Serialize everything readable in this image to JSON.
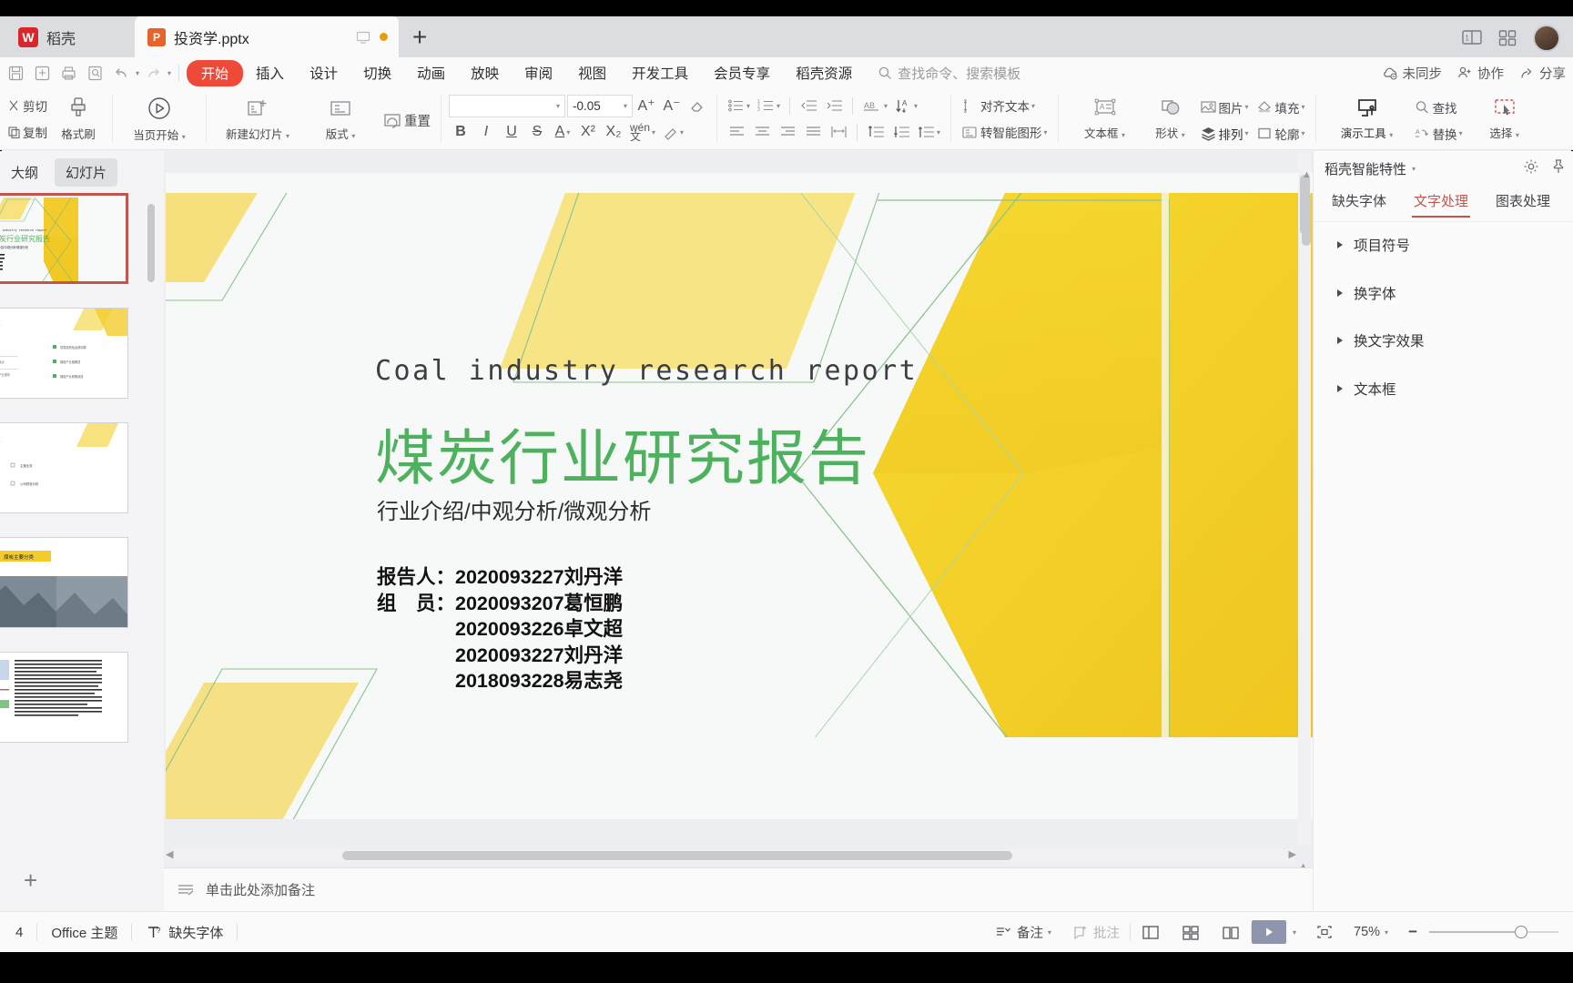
{
  "titlebar": {
    "home_label": "稻壳",
    "logo_glyph": "W",
    "doc_tab": {
      "name": "投资学.pptx",
      "icon_glyph": "P"
    },
    "new_tab_glyph": "+",
    "right_icons": [
      "split-view-icon",
      "grid-view-icon",
      "avatar"
    ]
  },
  "menubar": {
    "quick_access": [
      "save-icon",
      "save-as-icon",
      "print-icon",
      "print-preview-icon",
      "undo-icon",
      "redo-icon",
      "qat-more-icon"
    ],
    "items": [
      {
        "label": "开始",
        "active": true
      },
      {
        "label": "插入",
        "active": false
      },
      {
        "label": "设计",
        "active": false
      },
      {
        "label": "切换",
        "active": false
      },
      {
        "label": "动画",
        "active": false
      },
      {
        "label": "放映",
        "active": false
      },
      {
        "label": "审阅",
        "active": false
      },
      {
        "label": "视图",
        "active": false
      },
      {
        "label": "开发工具",
        "active": false
      },
      {
        "label": "会员专享",
        "active": false
      },
      {
        "label": "稻壳资源",
        "active": false
      }
    ],
    "search_placeholder": "查找命令、搜索模板",
    "right": [
      {
        "label": "未同步",
        "icon": "cloud-sync-icon"
      },
      {
        "label": "协作",
        "icon": "collaborate-icon"
      },
      {
        "label": "分享",
        "icon": "share-icon"
      }
    ]
  },
  "ribbon": {
    "clipboard": [
      {
        "label": "剪切",
        "icon": "cut-icon"
      },
      {
        "label": "复制",
        "icon": "copy-icon"
      },
      {
        "label": "格式刷",
        "icon": "format-painter-icon"
      }
    ],
    "present": {
      "label": "当页开始",
      "icon": "play-circle-icon"
    },
    "slides": [
      {
        "label": "新建幻灯片",
        "icon": "new-slide-icon"
      },
      {
        "label": "版式",
        "icon": "layout-icon"
      },
      {
        "label": "重置",
        "icon": "reset-icon"
      }
    ],
    "font_name": "",
    "font_size": "-0.05",
    "font_buttons": [
      {
        "label": "A⁺",
        "name": "increase-font-size-button"
      },
      {
        "label": "A⁻",
        "name": "decrease-font-size-button"
      },
      {
        "label": "",
        "name": "clear-format-button"
      }
    ],
    "format_row": [
      "B",
      "I",
      "U",
      "S",
      "A",
      "X²",
      "X₂",
      "wén",
      "highlight"
    ],
    "paragraph": [
      "bullet-list",
      "numbered-list",
      "decrease-indent",
      "increase-indent",
      "text-direction",
      "sort",
      "align-left",
      "align-center",
      "align-right",
      "justify",
      "distribute",
      "line-spacing-up",
      "line-spacing-mid",
      "line-spacing-down"
    ],
    "align_text": {
      "label": "对齐文本",
      "icon": "align-text-icon"
    },
    "smartart": {
      "label": "转智能图形",
      "icon": "smartart-icon"
    },
    "textbox": {
      "label": "文本框",
      "icon": "textbox-icon"
    },
    "shape": {
      "label": "形状",
      "icon": "shape-icon"
    },
    "arrange": {
      "label": "排列",
      "icon": "arrange-icon"
    },
    "picture": {
      "label": "图片",
      "icon": "picture-icon"
    },
    "fill": {
      "label": "填充",
      "icon": "fill-icon"
    },
    "outline": {
      "label": "轮廓",
      "icon": "outline-icon"
    },
    "present_tools": {
      "label": "演示工具",
      "icon": "present-tools-icon"
    },
    "find": {
      "label": "查找",
      "icon": "search-icon"
    },
    "replace": {
      "label": "替换",
      "icon": "replace-icon"
    },
    "select": {
      "label": "选择",
      "icon": "select-icon"
    }
  },
  "leftpanel": {
    "tabs": [
      {
        "label": "大纲",
        "active": false
      },
      {
        "label": "幻灯片",
        "active": true
      }
    ],
    "add_slide_glyph": "+",
    "thumbnails": [
      {
        "index": 1,
        "selected": true,
        "kind": "cover"
      },
      {
        "index": 2,
        "selected": false,
        "kind": "toc"
      },
      {
        "index": 3,
        "selected": false,
        "kind": "toc2"
      },
      {
        "index": 4,
        "selected": false,
        "kind": "photo",
        "caption": "煤炭主要分类"
      },
      {
        "index": 5,
        "selected": false,
        "kind": "text"
      }
    ]
  },
  "slide": {
    "title_en": "Coal industry research report",
    "title_cn": "煤炭行业研究报告",
    "subtitle": "行业介绍/中观分析/微观分析",
    "people": "报告人：2020093227刘丹洋\n组　员：2020093207葛恒鹏\n　　　　2020093226卓文超\n　　　　2020093227刘丹洋\n　　　　2018093228易志尧",
    "accent_green": "#4eb15e",
    "accent_yellow": "#f2d33e",
    "background": "#f7f9f9"
  },
  "notes": {
    "placeholder": "单击此处添加备注",
    "icon": "notes-icon"
  },
  "rightpanel": {
    "title": "稻壳智能特性",
    "head_icons": [
      "gear-icon",
      "pin-icon"
    ],
    "tabs": [
      {
        "label": "缺失字体",
        "active": false
      },
      {
        "label": "文字处理",
        "active": true
      },
      {
        "label": "图表处理",
        "active": false
      }
    ],
    "items": [
      {
        "label": "项目符号"
      },
      {
        "label": "换字体"
      },
      {
        "label": "换文字效果"
      },
      {
        "label": "文本框"
      }
    ]
  },
  "statusbar": {
    "slide_count": "4",
    "theme": "Office 主题",
    "font_status": "缺失字体",
    "font_status_icon": "missing-font-icon",
    "notes_btn": "备注",
    "comment_btn": "批注",
    "view_buttons": [
      "normal-view-icon",
      "slide-sorter-icon",
      "reading-view-icon"
    ],
    "play_glyph": "▶",
    "zoom": "75%",
    "zoom_fit_icon": "fit-to-window-icon",
    "minus_glyph": "−"
  }
}
